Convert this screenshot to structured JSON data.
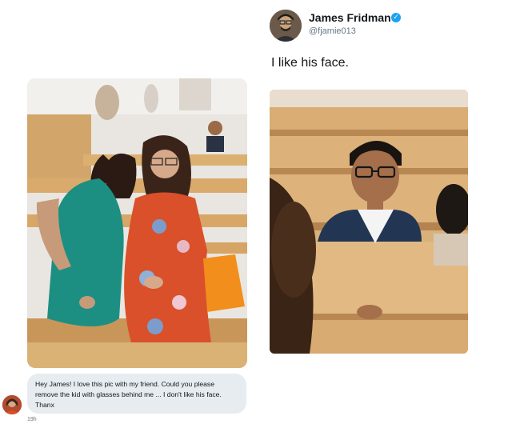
{
  "tweet": {
    "author_name": "James Fridman",
    "handle": "@fjamie013",
    "verified_icon": "verified-badge-icon",
    "text": "I like his face."
  },
  "message": {
    "text": "Hey James! I love this pic with my friend. Could you please remove the kid with glasses behind me  ... I don't like his face. Thanx",
    "time": "19h"
  },
  "colors": {
    "verified": "#1da1f2",
    "bubble": "#e6ecf0",
    "handle": "#657786"
  }
}
